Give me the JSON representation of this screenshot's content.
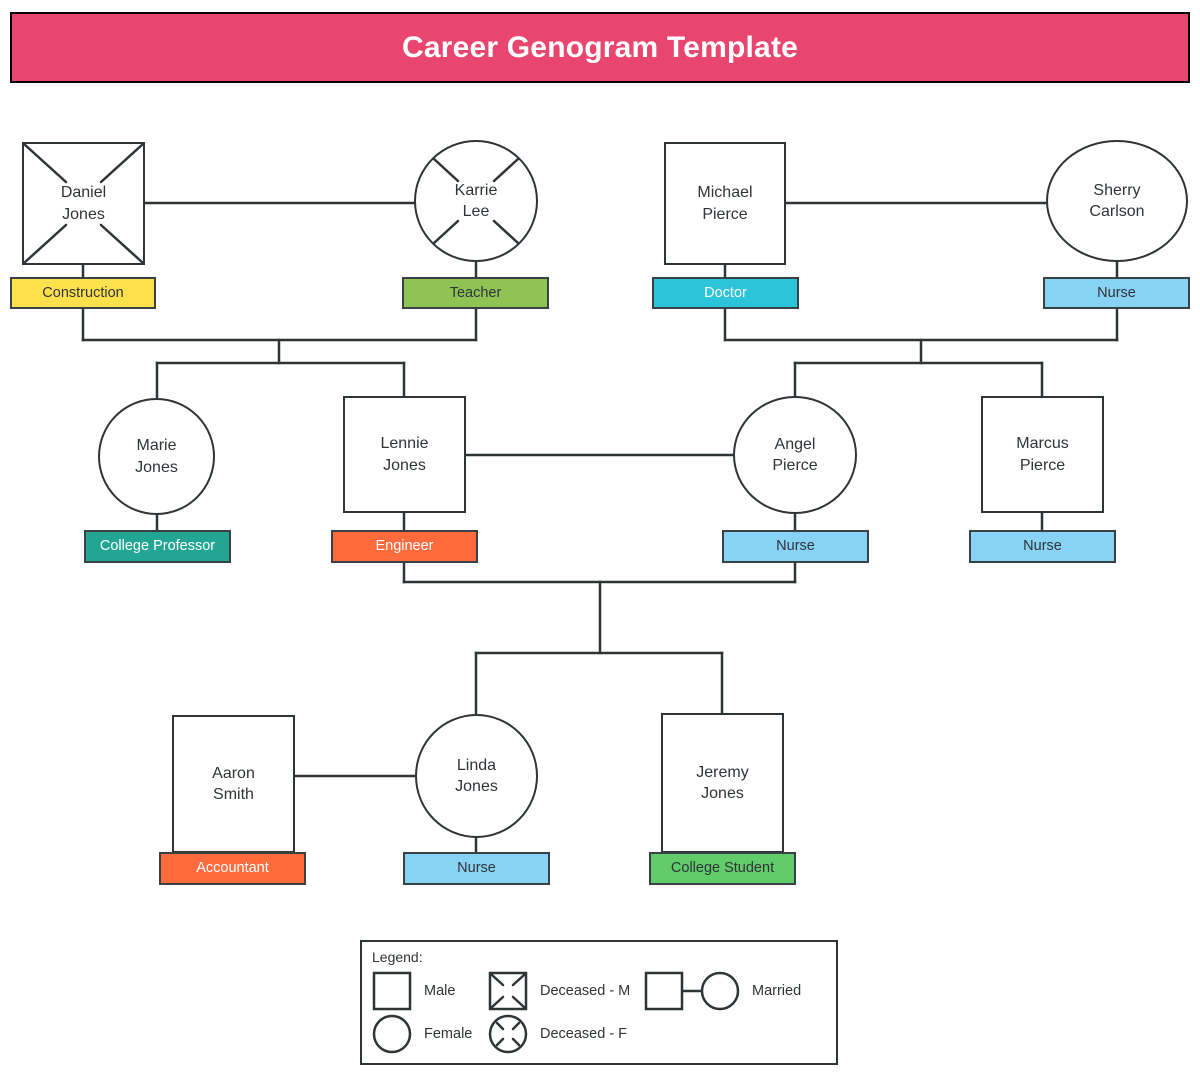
{
  "title": {
    "text": "Career Genogram Template",
    "background": "#e8456f",
    "text_color": "#ffffff"
  },
  "people": [
    {
      "id": "daniel",
      "name": "Daniel\nJones",
      "gender": "male",
      "deceased": true,
      "generation": 1
    },
    {
      "id": "karrie",
      "name": "Karrie\nLee",
      "gender": "female",
      "deceased": true,
      "generation": 1
    },
    {
      "id": "michael",
      "name": "Michael\nPierce",
      "gender": "male",
      "deceased": false,
      "generation": 1
    },
    {
      "id": "sherry",
      "name": "Sherry\nCarlson",
      "gender": "female",
      "deceased": false,
      "generation": 1
    },
    {
      "id": "marie",
      "name": "Marie\nJones",
      "gender": "female",
      "deceased": false,
      "generation": 2
    },
    {
      "id": "lennie",
      "name": "Lennie\nJones",
      "gender": "male",
      "deceased": false,
      "generation": 2
    },
    {
      "id": "angel",
      "name": "Angel\nPierce",
      "gender": "female",
      "deceased": false,
      "generation": 2
    },
    {
      "id": "marcus",
      "name": "Marcus\nPierce",
      "gender": "male",
      "deceased": false,
      "generation": 2
    },
    {
      "id": "aaron",
      "name": "Aaron\nSmith",
      "gender": "male",
      "deceased": false,
      "generation": 3
    },
    {
      "id": "linda",
      "name": "Linda\nJones",
      "gender": "female",
      "deceased": false,
      "generation": 3
    },
    {
      "id": "jeremy",
      "name": "Jeremy\nJones",
      "gender": "male",
      "deceased": false,
      "generation": 3
    }
  ],
  "careers": [
    {
      "person": "daniel",
      "label": "Construction",
      "bg": "#ffe14d",
      "fg": "#2f3437"
    },
    {
      "person": "karrie",
      "label": "Teacher",
      "bg": "#8fc455",
      "fg": "#2f3437"
    },
    {
      "person": "michael",
      "label": "Doctor",
      "bg": "#2bc4d9",
      "fg": "#ffffff"
    },
    {
      "person": "sherry",
      "label": "Nurse",
      "bg": "#87d2f5",
      "fg": "#2f3437"
    },
    {
      "person": "marie",
      "label": "College Professor",
      "bg": "#23a593",
      "fg": "#ffffff"
    },
    {
      "person": "lennie",
      "label": "Engineer",
      "bg": "#ff6b3d",
      "fg": "#ffffff"
    },
    {
      "person": "angel",
      "label": "Nurse",
      "bg": "#87d2f5",
      "fg": "#2f3437"
    },
    {
      "person": "marcus",
      "label": "Nurse",
      "bg": "#87d2f5",
      "fg": "#2f3437"
    },
    {
      "person": "aaron",
      "label": "Accountant",
      "bg": "#ff6b3d",
      "fg": "#ffffff"
    },
    {
      "person": "linda",
      "label": "Nurse",
      "bg": "#87d2f5",
      "fg": "#2f3437"
    },
    {
      "person": "jeremy",
      "label": "College Student",
      "bg": "#62cc6b",
      "fg": "#2f3437"
    }
  ],
  "legend": {
    "title": "Legend:",
    "items": [
      {
        "symbol": "male-square",
        "label": "Male"
      },
      {
        "symbol": "female-circle",
        "label": "Female"
      },
      {
        "symbol": "deceased-square",
        "label": "Deceased - M"
      },
      {
        "symbol": "deceased-circle",
        "label": "Deceased - F"
      },
      {
        "symbol": "married-link",
        "label": "Married"
      }
    ]
  },
  "relationships": {
    "marriages": [
      {
        "left": "daniel",
        "right": "karrie",
        "children": [
          "marie",
          "lennie"
        ]
      },
      {
        "left": "michael",
        "right": "sherry",
        "children": [
          "angel",
          "marcus"
        ]
      },
      {
        "left": "lennie",
        "right": "angel",
        "children": [
          "linda",
          "jeremy"
        ]
      },
      {
        "left": "aaron",
        "right": "linda",
        "children": []
      }
    ]
  },
  "colors": {
    "stroke": "#2f3437",
    "node_fill": "#ffffff",
    "page_bg": "#ffffff"
  }
}
